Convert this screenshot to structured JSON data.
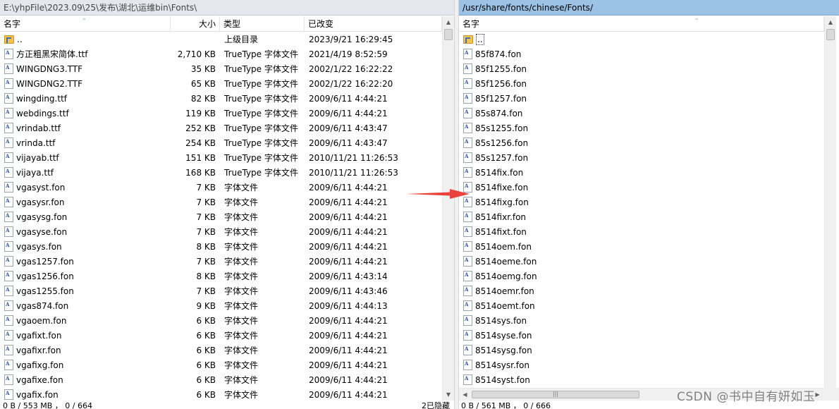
{
  "left": {
    "path": "E:\\yhpFile\\2023.09\\25\\发布\\湖北\\运维bin\\Fonts\\",
    "columns": {
      "name": "名字",
      "size": "大小",
      "type": "类型",
      "modified": "已改变"
    },
    "rows": [
      {
        "icon": "parent-folder-icon",
        "name": "..",
        "size": "",
        "type": "上级目录",
        "modified": "2023/9/21   16:29:45"
      },
      {
        "icon": "font-file-icon",
        "name": "方正粗黑宋简体.ttf",
        "size": "2,710 KB",
        "type": "TrueType 字体文件",
        "modified": "2021/4/19   8:52:59"
      },
      {
        "icon": "font-file-icon",
        "name": "WINGDNG3.TTF",
        "size": "35 KB",
        "type": "TrueType 字体文件",
        "modified": "2002/1/22   16:22:22"
      },
      {
        "icon": "font-file-icon",
        "name": "WINGDNG2.TTF",
        "size": "65 KB",
        "type": "TrueType 字体文件",
        "modified": "2002/1/22   16:22:20"
      },
      {
        "icon": "font-file-icon",
        "name": "wingding.ttf",
        "size": "82 KB",
        "type": "TrueType 字体文件",
        "modified": "2009/6/11   4:44:21"
      },
      {
        "icon": "font-file-icon",
        "name": "webdings.ttf",
        "size": "119 KB",
        "type": "TrueType 字体文件",
        "modified": "2009/6/11   4:44:21"
      },
      {
        "icon": "font-file-icon",
        "name": "vrindab.ttf",
        "size": "252 KB",
        "type": "TrueType 字体文件",
        "modified": "2009/6/11   4:43:47"
      },
      {
        "icon": "font-file-icon",
        "name": "vrinda.ttf",
        "size": "254 KB",
        "type": "TrueType 字体文件",
        "modified": "2009/6/11   4:43:47"
      },
      {
        "icon": "font-file-icon",
        "name": "vijayab.ttf",
        "size": "151 KB",
        "type": "TrueType 字体文件",
        "modified": "2010/11/21   11:26:53"
      },
      {
        "icon": "font-file-icon",
        "name": "vijaya.ttf",
        "size": "168 KB",
        "type": "TrueType 字体文件",
        "modified": "2010/11/21   11:26:53"
      },
      {
        "icon": "font-file-icon",
        "name": "vgasyst.fon",
        "size": "7 KB",
        "type": "字体文件",
        "modified": "2009/6/11   4:44:21"
      },
      {
        "icon": "font-file-icon",
        "name": "vgasysr.fon",
        "size": "7 KB",
        "type": "字体文件",
        "modified": "2009/6/11   4:44:21"
      },
      {
        "icon": "font-file-icon",
        "name": "vgasysg.fon",
        "size": "7 KB",
        "type": "字体文件",
        "modified": "2009/6/11   4:44:21"
      },
      {
        "icon": "font-file-icon",
        "name": "vgasyse.fon",
        "size": "7 KB",
        "type": "字体文件",
        "modified": "2009/6/11   4:44:21"
      },
      {
        "icon": "font-file-icon",
        "name": "vgasys.fon",
        "size": "8 KB",
        "type": "字体文件",
        "modified": "2009/6/11   4:44:21"
      },
      {
        "icon": "font-file-icon",
        "name": "vgas1257.fon",
        "size": "7 KB",
        "type": "字体文件",
        "modified": "2009/6/11   4:44:21"
      },
      {
        "icon": "font-file-icon",
        "name": "vgas1256.fon",
        "size": "8 KB",
        "type": "字体文件",
        "modified": "2009/6/11   4:43:14"
      },
      {
        "icon": "font-file-icon",
        "name": "vgas1255.fon",
        "size": "7 KB",
        "type": "字体文件",
        "modified": "2009/6/11   4:43:46"
      },
      {
        "icon": "font-file-icon",
        "name": "vgas874.fon",
        "size": "9 KB",
        "type": "字体文件",
        "modified": "2009/6/11   4:44:13"
      },
      {
        "icon": "font-file-icon",
        "name": "vgaoem.fon",
        "size": "6 KB",
        "type": "字体文件",
        "modified": "2009/6/11   4:44:21"
      },
      {
        "icon": "font-file-icon",
        "name": "vgafixt.fon",
        "size": "6 KB",
        "type": "字体文件",
        "modified": "2009/6/11   4:44:21"
      },
      {
        "icon": "font-file-icon",
        "name": "vgafixr.fon",
        "size": "6 KB",
        "type": "字体文件",
        "modified": "2009/6/11   4:44:21"
      },
      {
        "icon": "font-file-icon",
        "name": "vgafixg.fon",
        "size": "6 KB",
        "type": "字体文件",
        "modified": "2009/6/11   4:44:21"
      },
      {
        "icon": "font-file-icon",
        "name": "vgafixe.fon",
        "size": "6 KB",
        "type": "字体文件",
        "modified": "2009/6/11   4:44:21"
      },
      {
        "icon": "font-file-icon",
        "name": "vgafix.fon",
        "size": "6 KB",
        "type": "字体文件",
        "modified": "2009/6/11   4:44:21"
      }
    ],
    "status": "0 B / 553 MB ，  0 / 664"
  },
  "right": {
    "path": "/usr/share/fonts/chinese/Fonts/",
    "columns": {
      "name": "名字"
    },
    "rows": [
      {
        "icon": "parent-folder-icon",
        "name": ".."
      },
      {
        "icon": "font-file-icon",
        "name": "85f874.fon"
      },
      {
        "icon": "font-file-icon",
        "name": "85f1255.fon"
      },
      {
        "icon": "font-file-icon",
        "name": "85f1256.fon"
      },
      {
        "icon": "font-file-icon",
        "name": "85f1257.fon"
      },
      {
        "icon": "font-file-icon",
        "name": "85s874.fon"
      },
      {
        "icon": "font-file-icon",
        "name": "85s1255.fon"
      },
      {
        "icon": "font-file-icon",
        "name": "85s1256.fon"
      },
      {
        "icon": "font-file-icon",
        "name": "85s1257.fon"
      },
      {
        "icon": "font-file-icon",
        "name": "8514fix.fon"
      },
      {
        "icon": "font-file-icon",
        "name": "8514fixe.fon"
      },
      {
        "icon": "font-file-icon",
        "name": "8514fixg.fon"
      },
      {
        "icon": "font-file-icon",
        "name": "8514fixr.fon"
      },
      {
        "icon": "font-file-icon",
        "name": "8514fixt.fon"
      },
      {
        "icon": "font-file-icon",
        "name": "8514oem.fon"
      },
      {
        "icon": "font-file-icon",
        "name": "8514oeme.fon"
      },
      {
        "icon": "font-file-icon",
        "name": "8514oemg.fon"
      },
      {
        "icon": "font-file-icon",
        "name": "8514oemr.fon"
      },
      {
        "icon": "font-file-icon",
        "name": "8514oemt.fon"
      },
      {
        "icon": "font-file-icon",
        "name": "8514sys.fon"
      },
      {
        "icon": "font-file-icon",
        "name": "8514syse.fon"
      },
      {
        "icon": "font-file-icon",
        "name": "8514sysg.fon"
      },
      {
        "icon": "font-file-icon",
        "name": "8514sysr.fon"
      },
      {
        "icon": "font-file-icon",
        "name": "8514syst.fon"
      }
    ],
    "hscroll_grip": "|||",
    "status_left": "2已隐藏",
    "status": "0 B / 561 MB ，  0 / 666"
  },
  "scroll_arrows": {
    "up": "▲",
    "down": "▼",
    "left": "◀",
    "right": "▶"
  },
  "sort_indicator": "⌃",
  "annotation_color": "#e8423a",
  "watermark": "CSDN @书中自有妍如玉"
}
